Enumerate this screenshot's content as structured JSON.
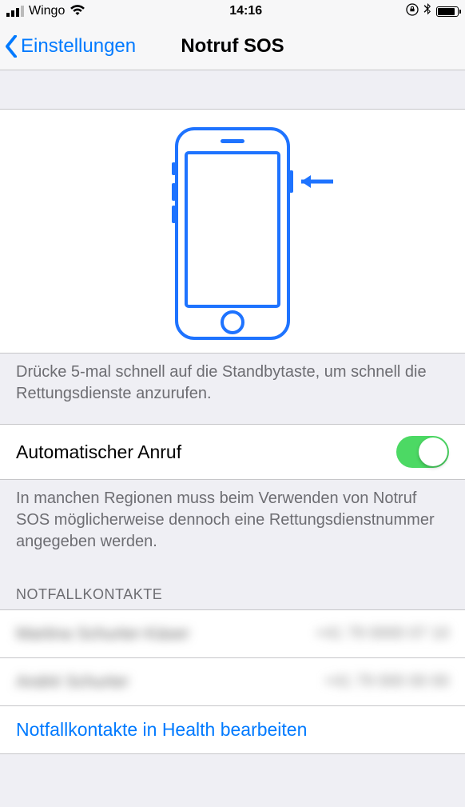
{
  "status": {
    "carrier": "Wingo",
    "time": "14:16"
  },
  "nav": {
    "back_label": "Einstellungen",
    "title": "Notruf SOS"
  },
  "hero": {
    "caption": "Drücke 5-mal schnell auf die Standbytaste, um schnell die Rettungsdienste anzurufen."
  },
  "auto_call": {
    "label": "Automatischer Anruf",
    "enabled": true,
    "footer": "In manchen Regionen muss beim Verwenden von Notruf SOS möglicherweise dennoch eine Rettungsdienstnummer angegeben werden."
  },
  "contacts": {
    "header": "NOTFALLKONTAKTE",
    "items": [
      {
        "name": "Martina Schurter-Käser",
        "phone": "+41 79 0000 07 10"
      },
      {
        "name": "André Schurter",
        "phone": "+41 79 000 00 00"
      }
    ],
    "edit_link": "Notfallkontakte in Health bearbeiten"
  }
}
